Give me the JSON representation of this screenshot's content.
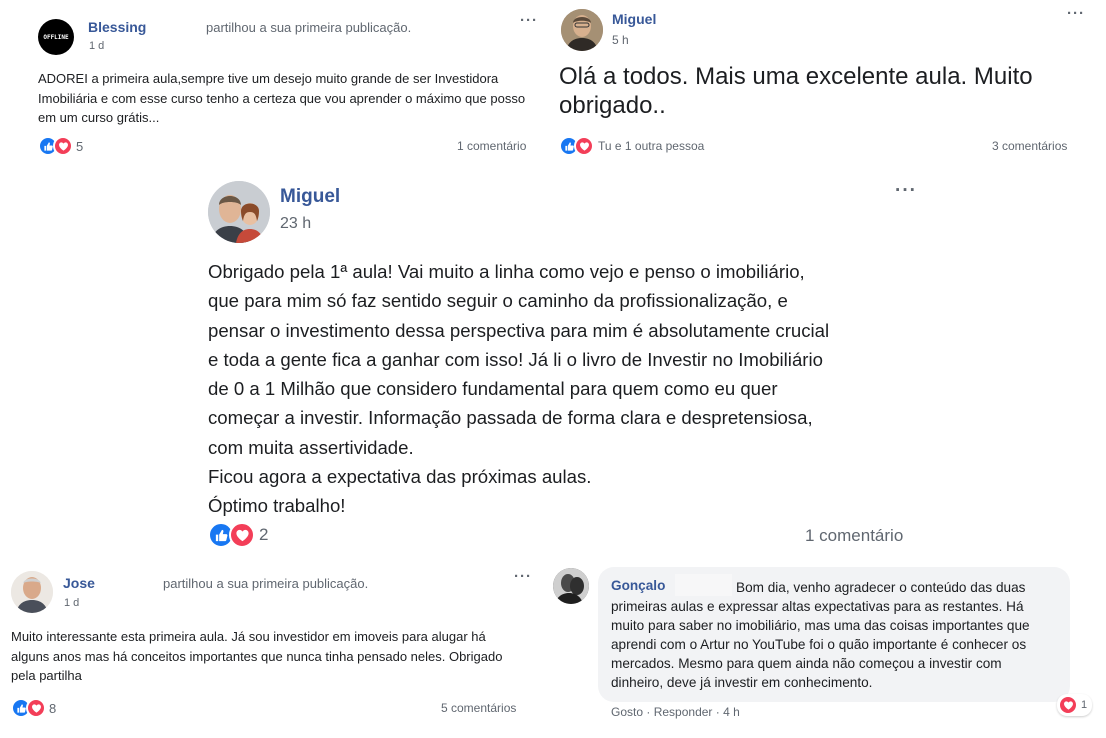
{
  "post_blessing": {
    "author": "Blessing",
    "action": "partilhou a sua primeira publicação.",
    "time": "1 d",
    "avatar_text": "OFFLINE",
    "text": "ADOREI a primeira aula,sempre tive um desejo muito grande de ser Investidora Imobiliária e com esse curso tenho a certeza que vou aprender o máximo que posso em um curso grátis...",
    "reactions_count": "5",
    "comments": "1 comentário",
    "more": "···"
  },
  "post_miguel_small": {
    "author": "Miguel",
    "time": "5 h",
    "text": "Olá a todos. Mais uma excelente aula. Muito obrigado..",
    "reactions_text": "Tu e 1 outra pessoa",
    "comments": "3 comentários",
    "more": "···"
  },
  "post_miguel_main": {
    "author": "Miguel",
    "time": "23 h",
    "lines": [
      "Obrigado pela 1ª aula! Vai muito a linha como vejo e penso o imobiliário,",
      "que para mim só faz sentido seguir o caminho da profissionalização, e",
      "pensar o investimento dessa perspectiva para mim é absolutamente crucial",
      "e toda a gente fica a ganhar com isso! Já li o livro de Investir no Imobiliário",
      "de 0 a 1 Milhão que considero fundamental para quem como eu quer",
      "começar a investir. Informação passada de forma clara e despretensiosa,",
      "com muita assertividade.",
      "Ficou agora a expectativa das próximas aulas.",
      "Óptimo trabalho!"
    ],
    "reactions_count": "2",
    "comments": "1 comentário",
    "more": "···"
  },
  "post_jose": {
    "author": "Jose",
    "action": "partilhou a sua primeira publicação.",
    "time": "1 d",
    "text": "Muito interessante esta primeira aula. Já sou investidor em imoveis para alugar há alguns anos mas há conceitos importantes que nunca tinha pensado neles. Obrigado pela partilha",
    "reactions_count": "8",
    "comments": "5 comentários",
    "more": "···"
  },
  "comment_goncalo": {
    "author": "Gonçalo",
    "text": "Bom dia, venho agradecer o conteúdo das duas primeiras aulas e expressar altas expectativas para as restantes. Há muito para saber no imobiliário, mas uma das coisas importantes que aprendi com o Artur no YouTube foi o quão importante é conhecer os mercados. Mesmo para quem ainda não começou a investir com dinheiro, deve já investir em conhecimento.",
    "like": "Gosto",
    "reply": "Responder",
    "time": "4 h",
    "reactions_count": "1"
  },
  "colors": {
    "link": "#385898",
    "like": "#1877f2",
    "love": "#f33e58",
    "meta": "#606770"
  }
}
